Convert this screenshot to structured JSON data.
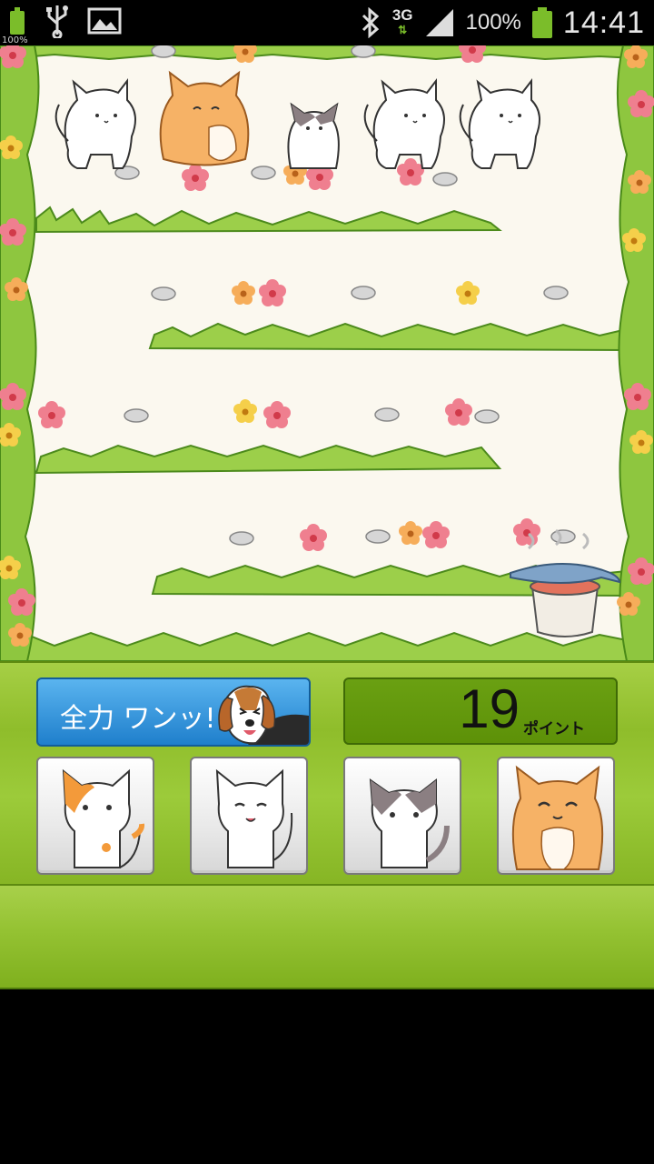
{
  "status_bar": {
    "battery_small_pct": "100%",
    "network": "3G",
    "battery_pct": "100%",
    "time": "14:41",
    "icons": [
      "battery-icon",
      "usb-icon",
      "image-icon",
      "bluetooth-icon",
      "signal-icon",
      "battery-icon"
    ]
  },
  "controls": {
    "dog_button_label": "全力 ワンッ!",
    "points_value": "19",
    "points_unit": "ポイント"
  },
  "cat_buttons": [
    {
      "name": "calico-cat"
    },
    {
      "name": "white-cat"
    },
    {
      "name": "gray-cat"
    },
    {
      "name": "orange-fat-cat"
    }
  ],
  "colors": {
    "panel_green": "#8fbd2b",
    "button_blue": "#1f7fcc",
    "points_green": "#5d9108",
    "field_bg": "#fbf8ef"
  }
}
